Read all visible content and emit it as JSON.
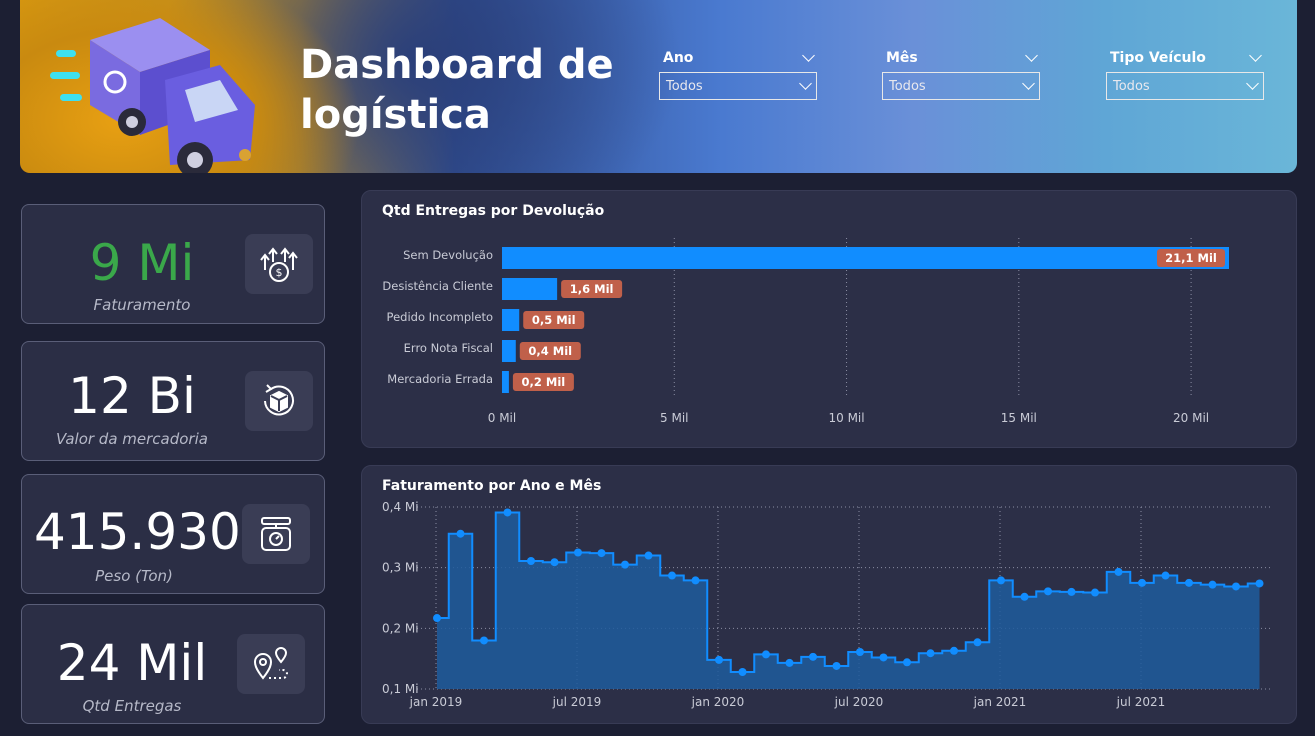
{
  "header": {
    "title_line1": "Dashboard de",
    "title_line2": "logística",
    "filters": [
      {
        "label": "Ano",
        "value": "Todos"
      },
      {
        "label": "Mês",
        "value": "Todos"
      },
      {
        "label": "Tipo Veículo",
        "value": "Todos"
      }
    ]
  },
  "kpis": [
    {
      "value": "9 Mi",
      "label": "Faturamento",
      "icon": "money-growth-icon",
      "color": "#3aa84a"
    },
    {
      "value": "12 Bi",
      "label": "Valor da mercadoria",
      "icon": "package-cycle-icon",
      "color": "#ffffff"
    },
    {
      "value": "415.930",
      "label": "Peso (Ton)",
      "icon": "scale-icon",
      "color": "#ffffff"
    },
    {
      "value": "24 Mil",
      "label": "Qtd Entregas",
      "icon": "route-pin-icon",
      "color": "#ffffff"
    }
  ],
  "chart_data": [
    {
      "type": "bar",
      "title": "Qtd Entregas por Devolução",
      "orientation": "horizontal",
      "categories": [
        "Sem Devolução",
        "Desistência Cliente",
        "Pedido Incompleto",
        "Erro Nota Fiscal",
        "Mercadoria Errada"
      ],
      "values": [
        21.1,
        1.6,
        0.5,
        0.4,
        0.2
      ],
      "data_labels": [
        "21,1 Mil",
        "1,6 Mil",
        "0,5 Mil",
        "0,4 Mil",
        "0,2 Mil"
      ],
      "xticks": [
        "0 Mil",
        "5 Mil",
        "10 Mil",
        "15 Mil",
        "20 Mil"
      ],
      "xlim": [
        0,
        21.1
      ],
      "bar_color": "#118dff",
      "label_color": "#c0604a",
      "grid": true
    },
    {
      "type": "area",
      "title": "Faturamento por Ano e Mês",
      "step": true,
      "x": [
        "2019-01",
        "2019-02",
        "2019-03",
        "2019-04",
        "2019-05",
        "2019-06",
        "2019-07",
        "2019-08",
        "2019-09",
        "2019-10",
        "2019-11",
        "2019-12",
        "2020-01",
        "2020-02",
        "2020-03",
        "2020-04",
        "2020-05",
        "2020-06",
        "2020-07",
        "2020-08",
        "2020-09",
        "2020-10",
        "2020-11",
        "2020-12",
        "2021-01",
        "2021-02",
        "2021-03",
        "2021-04",
        "2021-05",
        "2021-06",
        "2021-07",
        "2021-08",
        "2021-09",
        "2021-10",
        "2021-11",
        "2021-12"
      ],
      "values": [
        0.217,
        0.356,
        0.18,
        0.391,
        0.311,
        0.309,
        0.325,
        0.324,
        0.305,
        0.32,
        0.287,
        0.279,
        0.148,
        0.128,
        0.157,
        0.143,
        0.153,
        0.138,
        0.161,
        0.152,
        0.144,
        0.159,
        0.163,
        0.177,
        0.279,
        0.252,
        0.261,
        0.26,
        0.259,
        0.293,
        0.275,
        0.287,
        0.275,
        0.272,
        0.269,
        0.274
      ],
      "xticks": [
        "jan 2019",
        "jul 2019",
        "jan 2020",
        "jul 2020",
        "jan 2021",
        "jul 2021"
      ],
      "yticks": [
        "0,1 Mi",
        "0,2 Mi",
        "0,3 Mi",
        "0,4 Mi"
      ],
      "ylim": [
        0.1,
        0.4
      ],
      "line_color": "#118dff",
      "fill_color": "#1f5c9e",
      "grid": true
    }
  ]
}
